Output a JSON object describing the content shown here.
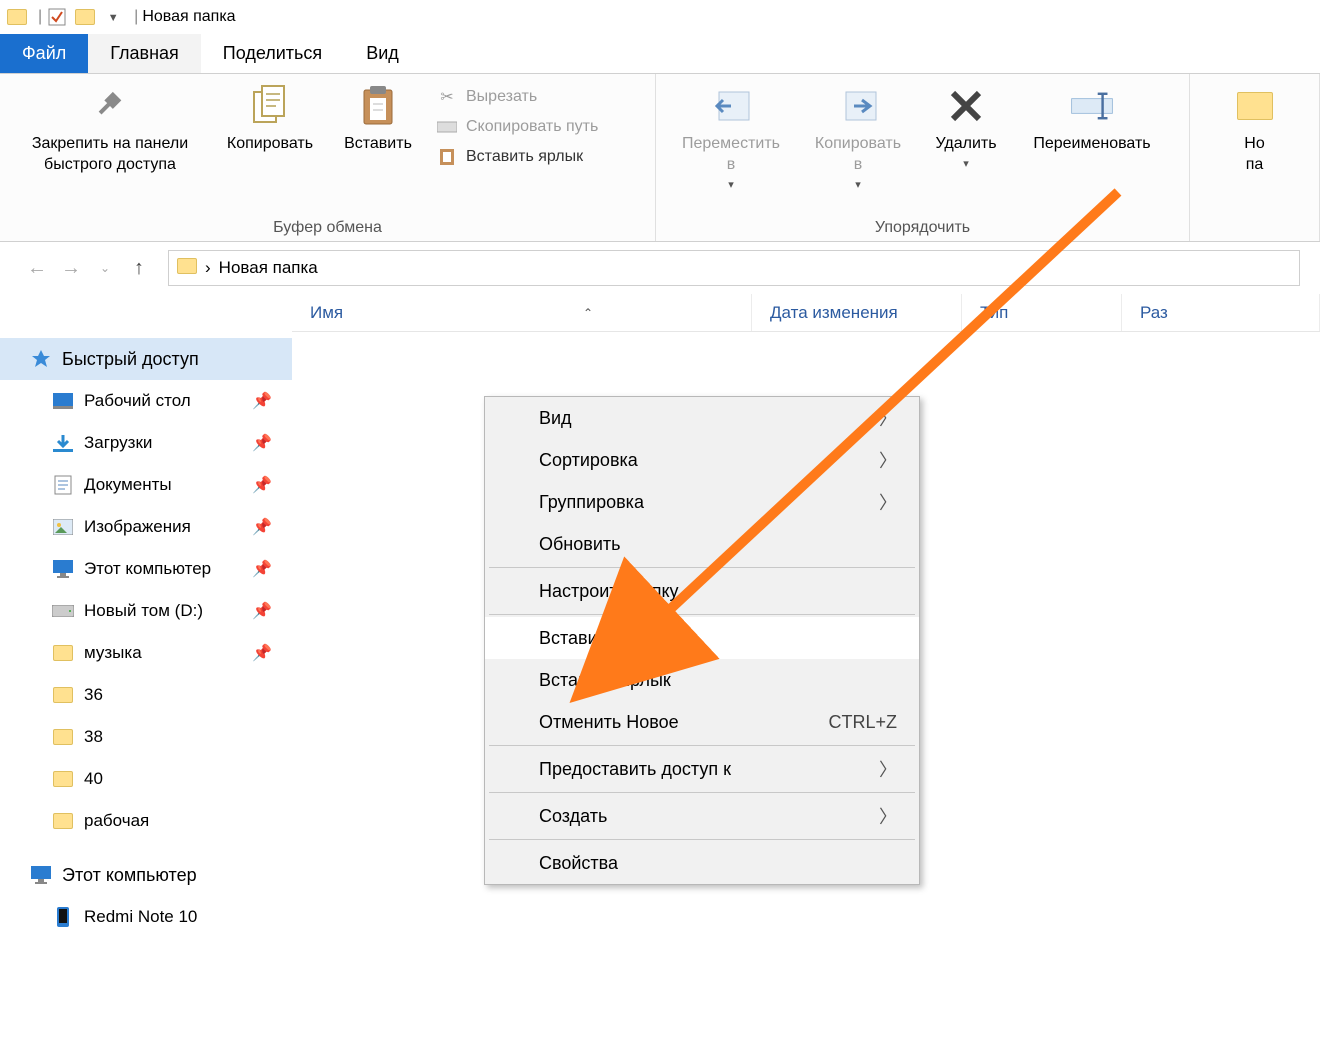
{
  "title": "Новая папка",
  "tabs": {
    "file": "Файл",
    "home": "Главная",
    "share": "Поделиться",
    "view": "Вид"
  },
  "ribbon": {
    "pin": "Закрепить на панели\nбыстрого доступа",
    "copy": "Копировать",
    "paste": "Вставить",
    "cut": "Вырезать",
    "copy_path": "Скопировать путь",
    "paste_shortcut": "Вставить ярлык",
    "group_clipboard": "Буфер обмена",
    "move_to": "Переместить\nв",
    "copy_to": "Копировать\nв",
    "delete": "Удалить",
    "rename": "Переименовать",
    "group_organize": "Упорядочить",
    "new_folder_frag": "Но\nпа"
  },
  "breadcrumb": {
    "folder": "Новая папка",
    "sep": "›"
  },
  "columns": {
    "name": "Имя",
    "date": "Дата изменения",
    "type": "Тип",
    "size": "Раз"
  },
  "sidebar": {
    "quick_access": "Быстрый доступ",
    "desktop": "Рабочий стол",
    "downloads": "Загрузки",
    "documents": "Документы",
    "pictures": "Изображения",
    "this_pc": "Этот компьютер",
    "new_volume": "Новый том (D:)",
    "music": "музыка",
    "f36": "36",
    "f38": "38",
    "f40": "40",
    "work": "рабочая",
    "this_pc2": "Этот компьютер",
    "redmi": "Redmi Note 10"
  },
  "ctx": {
    "view": "Вид",
    "sort": "Сортировка",
    "group": "Группировка",
    "refresh": "Обновить",
    "customize": "Настроить папку...",
    "paste": "Вставить",
    "paste_shortcut": "Вставить ярлык",
    "undo_new": "Отменить Новое",
    "undo_shortcut": "CTRL+Z",
    "share_access": "Предоставить доступ к",
    "create": "Создать",
    "properties": "Свойства"
  }
}
